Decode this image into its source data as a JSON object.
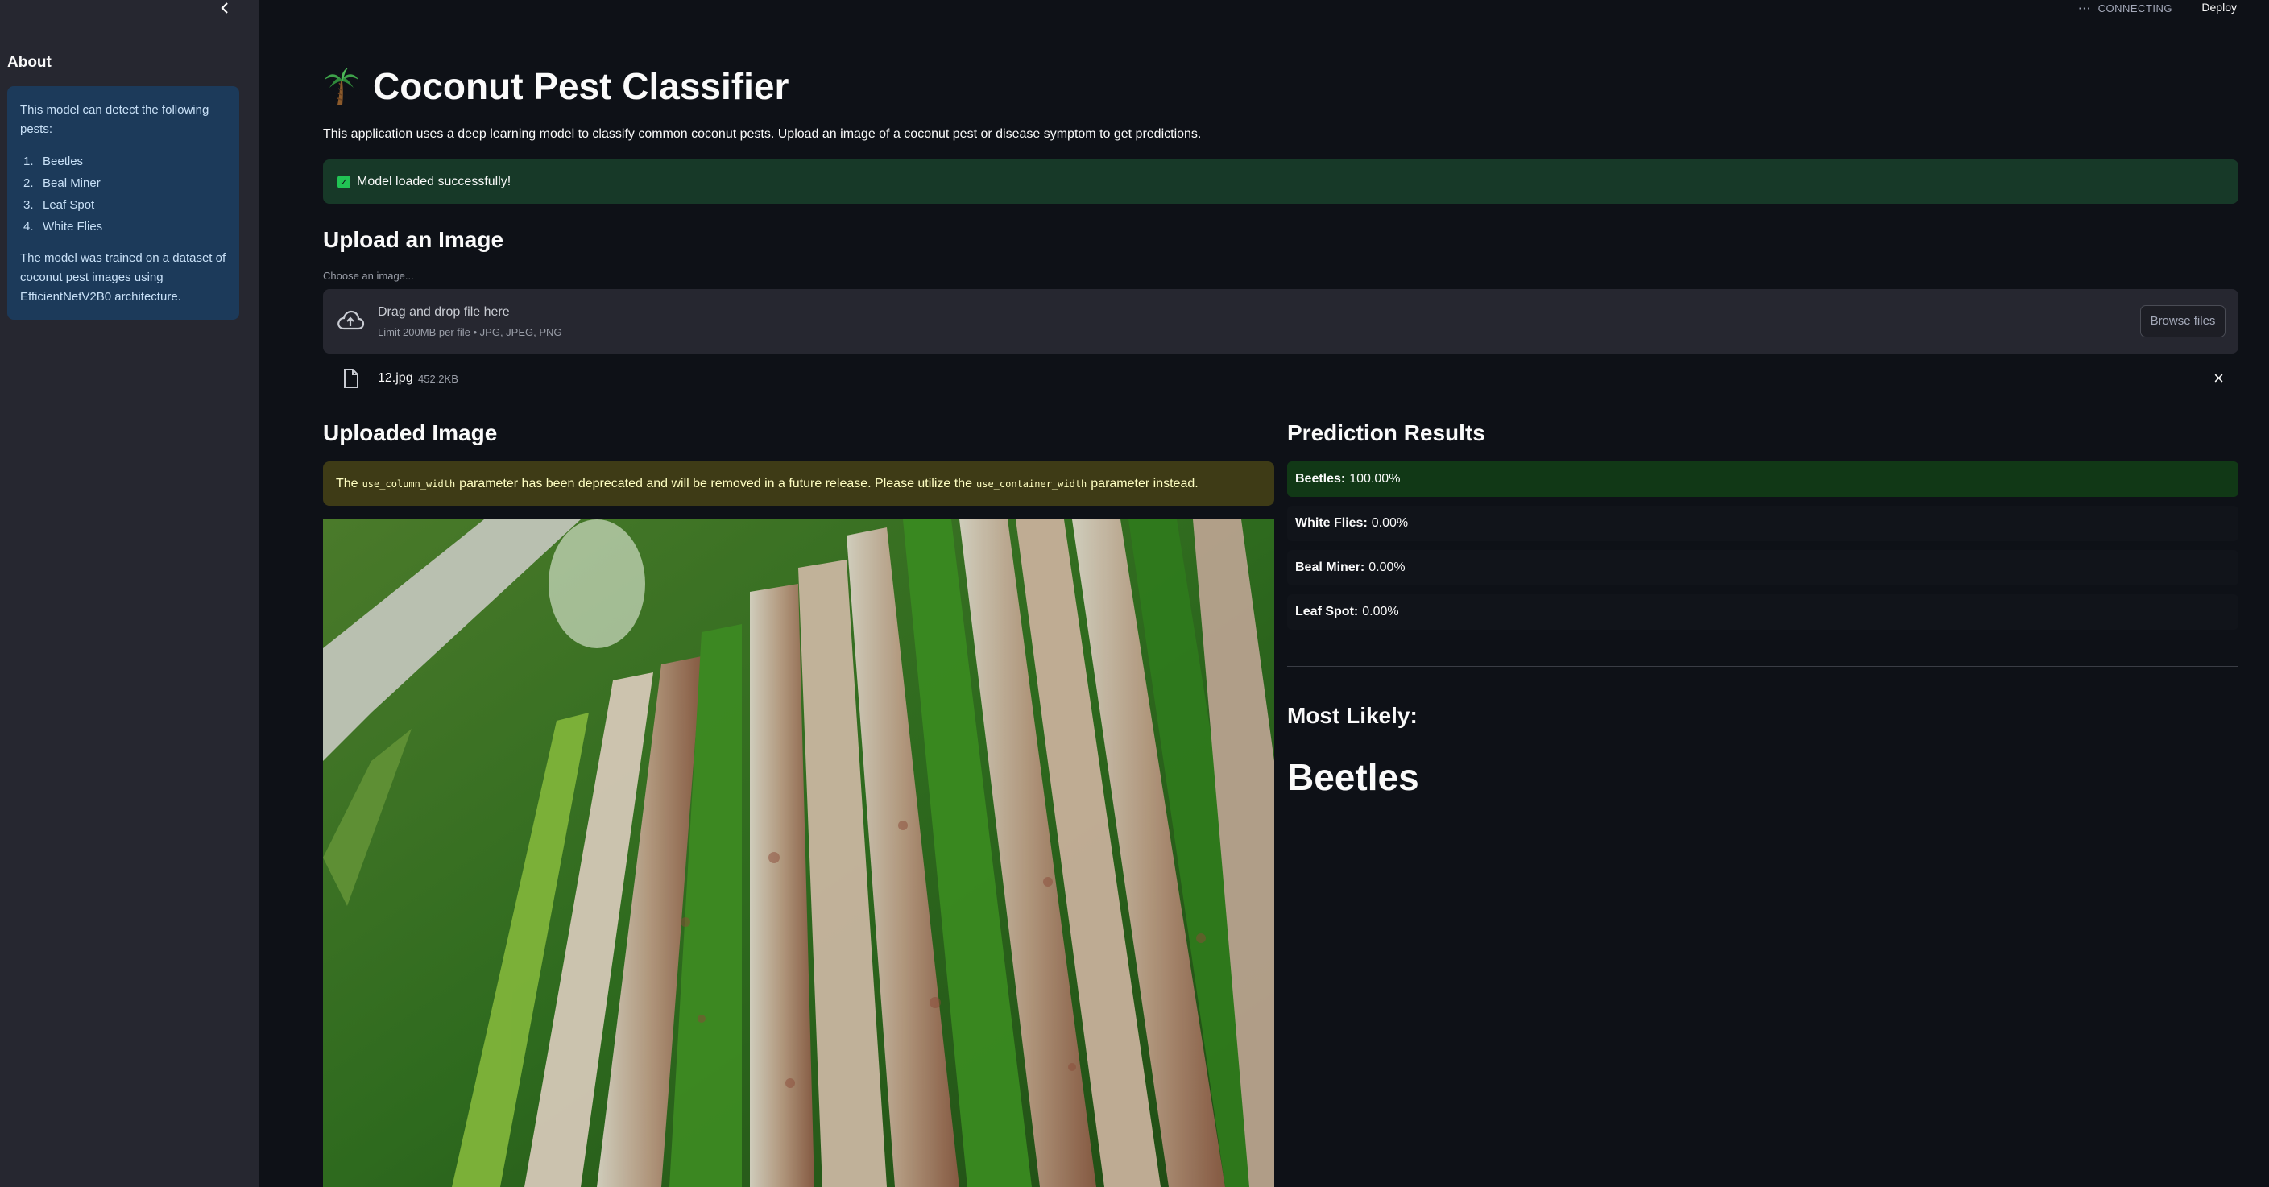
{
  "sidebar": {
    "collapse_icon": "chevron-left-icon",
    "about_title": "About",
    "intro": "This model can detect the following pests:",
    "pests": [
      {
        "num": "1.",
        "name": "Beetles"
      },
      {
        "num": "2.",
        "name": "Beal Miner"
      },
      {
        "num": "3.",
        "name": "Leaf Spot"
      },
      {
        "num": "4.",
        "name": "White Flies"
      }
    ],
    "outro": "The model was trained on a dataset of coconut pest images using EfficientNetV2B0 architecture."
  },
  "topbar": {
    "status": "CONNECTING",
    "deploy": "Deploy"
  },
  "main": {
    "title": "Coconut Pest Classifier",
    "title_icon": "palm-tree-icon",
    "subtitle": "This application uses a deep learning model to classify common coconut pests. Upload an image of a coconut pest or disease symptom to get predictions.",
    "success": "Model loaded successfully!",
    "upload_heading": "Upload an Image",
    "choose_label": "Choose an image...",
    "dropzone": {
      "main": "Drag and drop file here",
      "sub": "Limit 200MB per file • JPG, JPEG, PNG",
      "browse": "Browse files"
    },
    "file": {
      "name": "12.jpg",
      "size": "452.2KB"
    },
    "uploaded_heading": "Uploaded Image",
    "warning": {
      "p1": "The",
      "code1": "use_column_width",
      "p2": "parameter has been deprecated and will be removed in a future release. Please utilize the",
      "code2": "use_container_width",
      "p3": "parameter instead."
    }
  },
  "predictions": {
    "heading": "Prediction Results",
    "rows": [
      {
        "label": "Beetles:",
        "value": "100.00%"
      },
      {
        "label": "White Flies:",
        "value": "0.00%"
      },
      {
        "label": "Beal Miner:",
        "value": "0.00%"
      },
      {
        "label": "Leaf Spot:",
        "value": "0.00%"
      }
    ],
    "most_likely_label": "Most Likely:",
    "most_likely_value": "Beetles"
  },
  "colors": {
    "background": "#0e1117",
    "sidebar": "#262730",
    "success": "#173928",
    "warning": "#3e3b16",
    "top_prediction": "#113816"
  }
}
